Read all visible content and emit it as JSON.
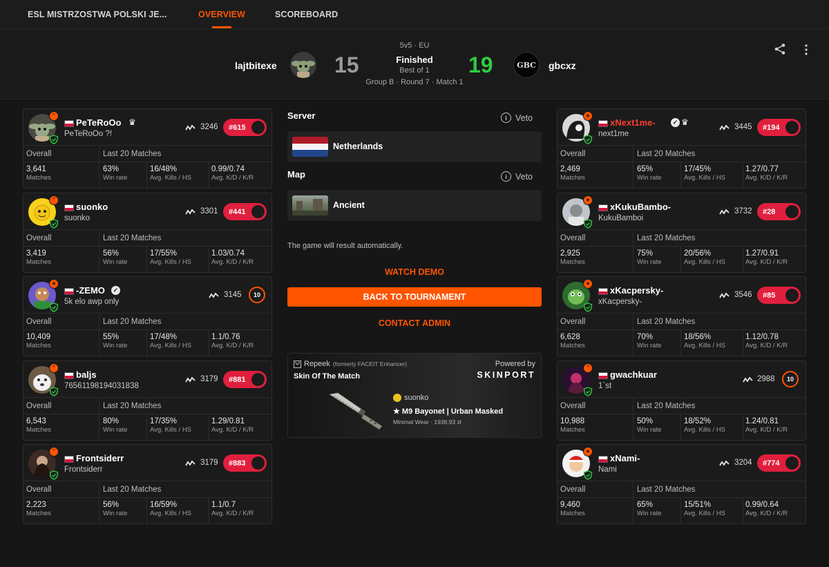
{
  "nav": {
    "tournament": "ESL MISTRZOSTWA POLSKI JE...",
    "tabs": [
      "OVERVIEW",
      "SCOREBOARD"
    ],
    "active_tab": "OVERVIEW"
  },
  "match": {
    "format": "5v5 · EU",
    "status": "Finished",
    "best_of": "Best of 1",
    "round_info": "Group B · Round 7 · Match 1",
    "team1": {
      "name": "lajtbitexe",
      "score": "15"
    },
    "team2": {
      "name": "gbcxz",
      "score": "19",
      "logo_text": "GBC"
    }
  },
  "colors": {
    "accent": "#ff5500",
    "winner_score": "#2ecc40",
    "loser_score": "#9a9a9a",
    "rank_pill": "#e01f3d"
  },
  "labels": {
    "overall": "Overall",
    "last20": "Last 20 Matches",
    "matches": "Matches",
    "win_rate": "Win rate",
    "kills_hs": "Avg. Kills / HS",
    "kd_kr": "Avg. K/D / K/R"
  },
  "left_players": [
    {
      "name": "PeTeRoOo",
      "sub": "PeTeRoOo ?!",
      "elo": "3246",
      "rank": "#615",
      "matches": "3,641",
      "win_rate": "63%",
      "kills_hs": "16/48%",
      "kd_kr": "0.99/0.74"
    },
    {
      "name": "suonko",
      "sub": "suonko",
      "elo": "3301",
      "rank": "#441",
      "matches": "3,419",
      "win_rate": "56%",
      "kills_hs": "17/55%",
      "kd_kr": "1.03/0.74"
    },
    {
      "name": "-ZEMO",
      "sub": "5k elo awp only",
      "elo": "3145",
      "level": "10",
      "matches": "10,409",
      "win_rate": "55%",
      "kills_hs": "17/48%",
      "kd_kr": "1.1/0.76"
    },
    {
      "name": "baljs",
      "sub": "76561198194031838",
      "elo": "3179",
      "rank": "#881",
      "matches": "6,543",
      "win_rate": "80%",
      "kills_hs": "17/35%",
      "kd_kr": "1.29/0.81"
    },
    {
      "name": "Frontsiderr",
      "sub": "Frontsiderr",
      "elo": "3179",
      "rank": "#883",
      "matches": "2,223",
      "win_rate": "56%",
      "kills_hs": "16/59%",
      "kd_kr": "1.1/0.7"
    }
  ],
  "right_players": [
    {
      "name": "xNext1me-",
      "sub": "next1me",
      "elo": "3445",
      "rank": "#194",
      "matches": "2,469",
      "win_rate": "65%",
      "kills_hs": "17/45%",
      "kd_kr": "1.27/0.77"
    },
    {
      "name": "xKukuBambo-",
      "sub": "KukuBamboi",
      "elo": "3732",
      "rank": "#28",
      "matches": "2,925",
      "win_rate": "75%",
      "kills_hs": "20/56%",
      "kd_kr": "1.27/0.91"
    },
    {
      "name": "xKacpersky-",
      "sub": "xKacpersky-",
      "elo": "3546",
      "rank": "#85",
      "matches": "6,628",
      "win_rate": "70%",
      "kills_hs": "18/56%",
      "kd_kr": "1.12/0.78"
    },
    {
      "name": "gwachkuar",
      "sub": "1`st",
      "elo": "2988",
      "level": "10",
      "matches": "10,988",
      "win_rate": "50%",
      "kills_hs": "18/52%",
      "kd_kr": "1.24/0.81"
    },
    {
      "name": "xNami-",
      "sub": "Nami",
      "elo": "3204",
      "rank": "#774",
      "matches": "9,460",
      "win_rate": "65%",
      "kills_hs": "15/51%",
      "kd_kr": "0.99/0.64"
    }
  ],
  "center": {
    "server_label": "Server",
    "veto": "Veto",
    "server": "Netherlands",
    "map_label": "Map",
    "map": "Ancient",
    "note": "The game will result automatically.",
    "watch_demo": "WATCH DEMO",
    "back": "BACK TO TOURNAMENT",
    "contact": "CONTACT ADMIN"
  },
  "skin": {
    "brand": "Repeek",
    "brand_note": "(formerly FACEIT Enhancer)",
    "powered_by": "Powered by",
    "sponsor": "SKINPORT",
    "title": "Skin Of The Match",
    "player": "suonko",
    "item": "★ M9 Bayonet | Urban Masked",
    "detail": "Minimal Wear · 1938,93 zł"
  }
}
